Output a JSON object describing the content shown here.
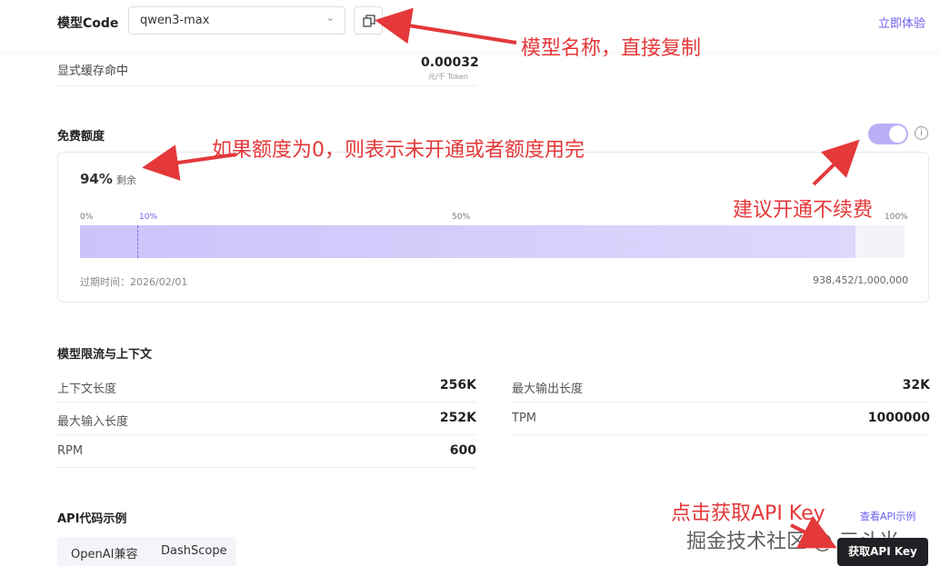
{
  "header": {
    "model_code_label": "模型Code",
    "model_value": "qwen3-max",
    "try_link": "立即体验"
  },
  "cache": {
    "label": "显式缓存命中",
    "value": "0.00032",
    "unit": "元/千 Token"
  },
  "free_quota": {
    "title": "免费额度",
    "percent": "94%",
    "remaining_label": "剩余",
    "ticks": [
      "0%",
      "10%",
      "50%",
      "100%"
    ],
    "fill_fraction": 0.94,
    "marker_fraction": 0.07,
    "expire": "过期时间：2026/02/01",
    "usage": "938,452/1,000,000",
    "toggle_on": true
  },
  "limits": {
    "title": "模型限流与上下文",
    "left": [
      {
        "label": "上下文长度",
        "value": "256K"
      },
      {
        "label": "最大输入长度",
        "value": "252K"
      },
      {
        "label": "RPM",
        "value": "600"
      }
    ],
    "right": [
      {
        "label": "最大输出长度",
        "value": "32K"
      },
      {
        "label": "TPM",
        "value": "1000000"
      }
    ]
  },
  "api": {
    "title": "API代码示例",
    "view_link": "查看API示例",
    "tabs": [
      "OpenAI兼容",
      "DashScope"
    ],
    "get_key_button": "获取API Key"
  },
  "watermark": "掘金技术社区 @ 三斗米",
  "annotations": {
    "model_name": "模型名称，直接复制",
    "quota_zero": "如果额度为0，则表示未开通或者额度用完",
    "renew": "建议开通不续费",
    "get_key": "点击获取API Key"
  },
  "colors": {
    "accent": "#6b5cf0",
    "annotation": "#e4383a",
    "bar_fill": "#cbc3fa",
    "toggle": "#b9aff6"
  }
}
